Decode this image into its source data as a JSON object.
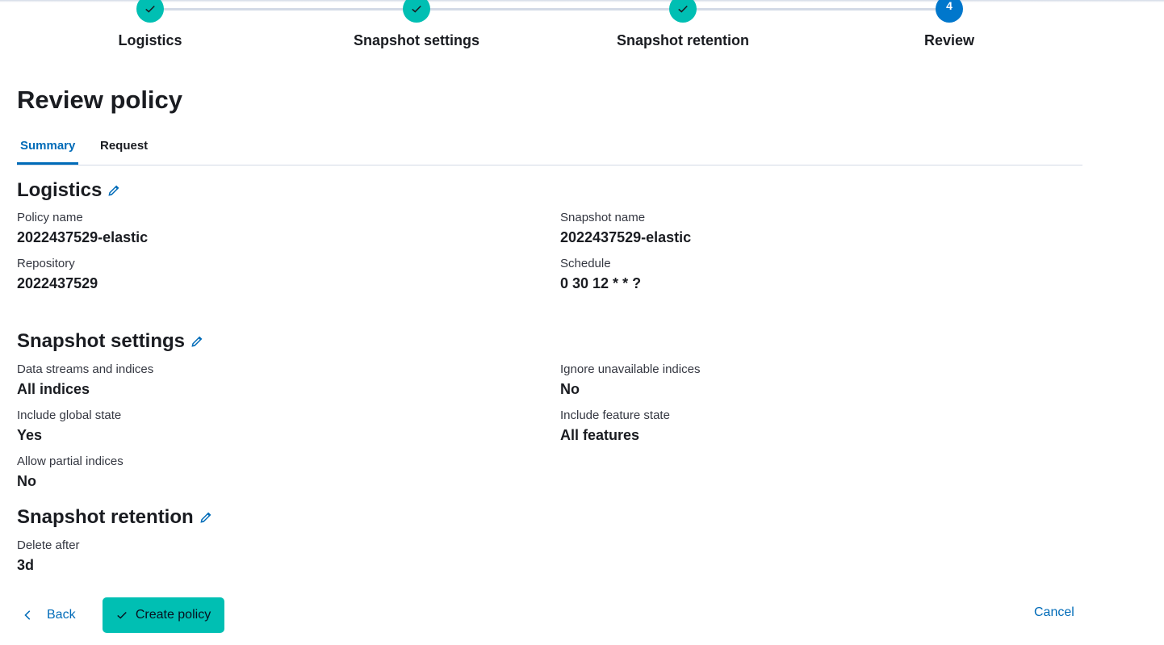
{
  "steps": [
    {
      "title": "Logistics",
      "status": "complete",
      "number": "1"
    },
    {
      "title": "Snapshot settings",
      "status": "complete",
      "number": "2"
    },
    {
      "title": "Snapshot retention",
      "status": "complete",
      "number": "3"
    },
    {
      "title": "Review",
      "status": "current",
      "number": "4"
    }
  ],
  "page_title": "Review policy",
  "tabs": [
    {
      "label": "Summary",
      "active": true
    },
    {
      "label": "Request",
      "active": false
    }
  ],
  "logistics": {
    "title": "Logistics",
    "policy_name_label": "Policy name",
    "policy_name_value": "2022437529-elastic",
    "snapshot_name_label": "Snapshot name",
    "snapshot_name_value": "2022437529-elastic",
    "repository_label": "Repository",
    "repository_value": "2022437529",
    "schedule_label": "Schedule",
    "schedule_value": "0 30 12 * * ?"
  },
  "snapshot_settings": {
    "title": "Snapshot settings",
    "data_streams_label": "Data streams and indices",
    "data_streams_value": "All indices",
    "ignore_unavailable_label": "Ignore unavailable indices",
    "ignore_unavailable_value": "No",
    "include_global_state_label": "Include global state",
    "include_global_state_value": "Yes",
    "include_feature_state_label": "Include feature state",
    "include_feature_state_value": "All features",
    "allow_partial_label": "Allow partial indices",
    "allow_partial_value": "No"
  },
  "snapshot_retention": {
    "title": "Snapshot retention",
    "delete_after_label": "Delete after",
    "delete_after_value": "3d"
  },
  "footer": {
    "back_label": "Back",
    "create_label": "Create policy",
    "cancel_label": "Cancel"
  },
  "colors": {
    "accent": "#006bb8",
    "step_complete": "#00bfb3",
    "step_current": "#0077cc",
    "primary_button": "#00bfb3"
  },
  "icons": {
    "step_complete": "check-icon",
    "edit": "pencil-icon",
    "back": "chevron-left-icon",
    "create": "check-icon"
  }
}
